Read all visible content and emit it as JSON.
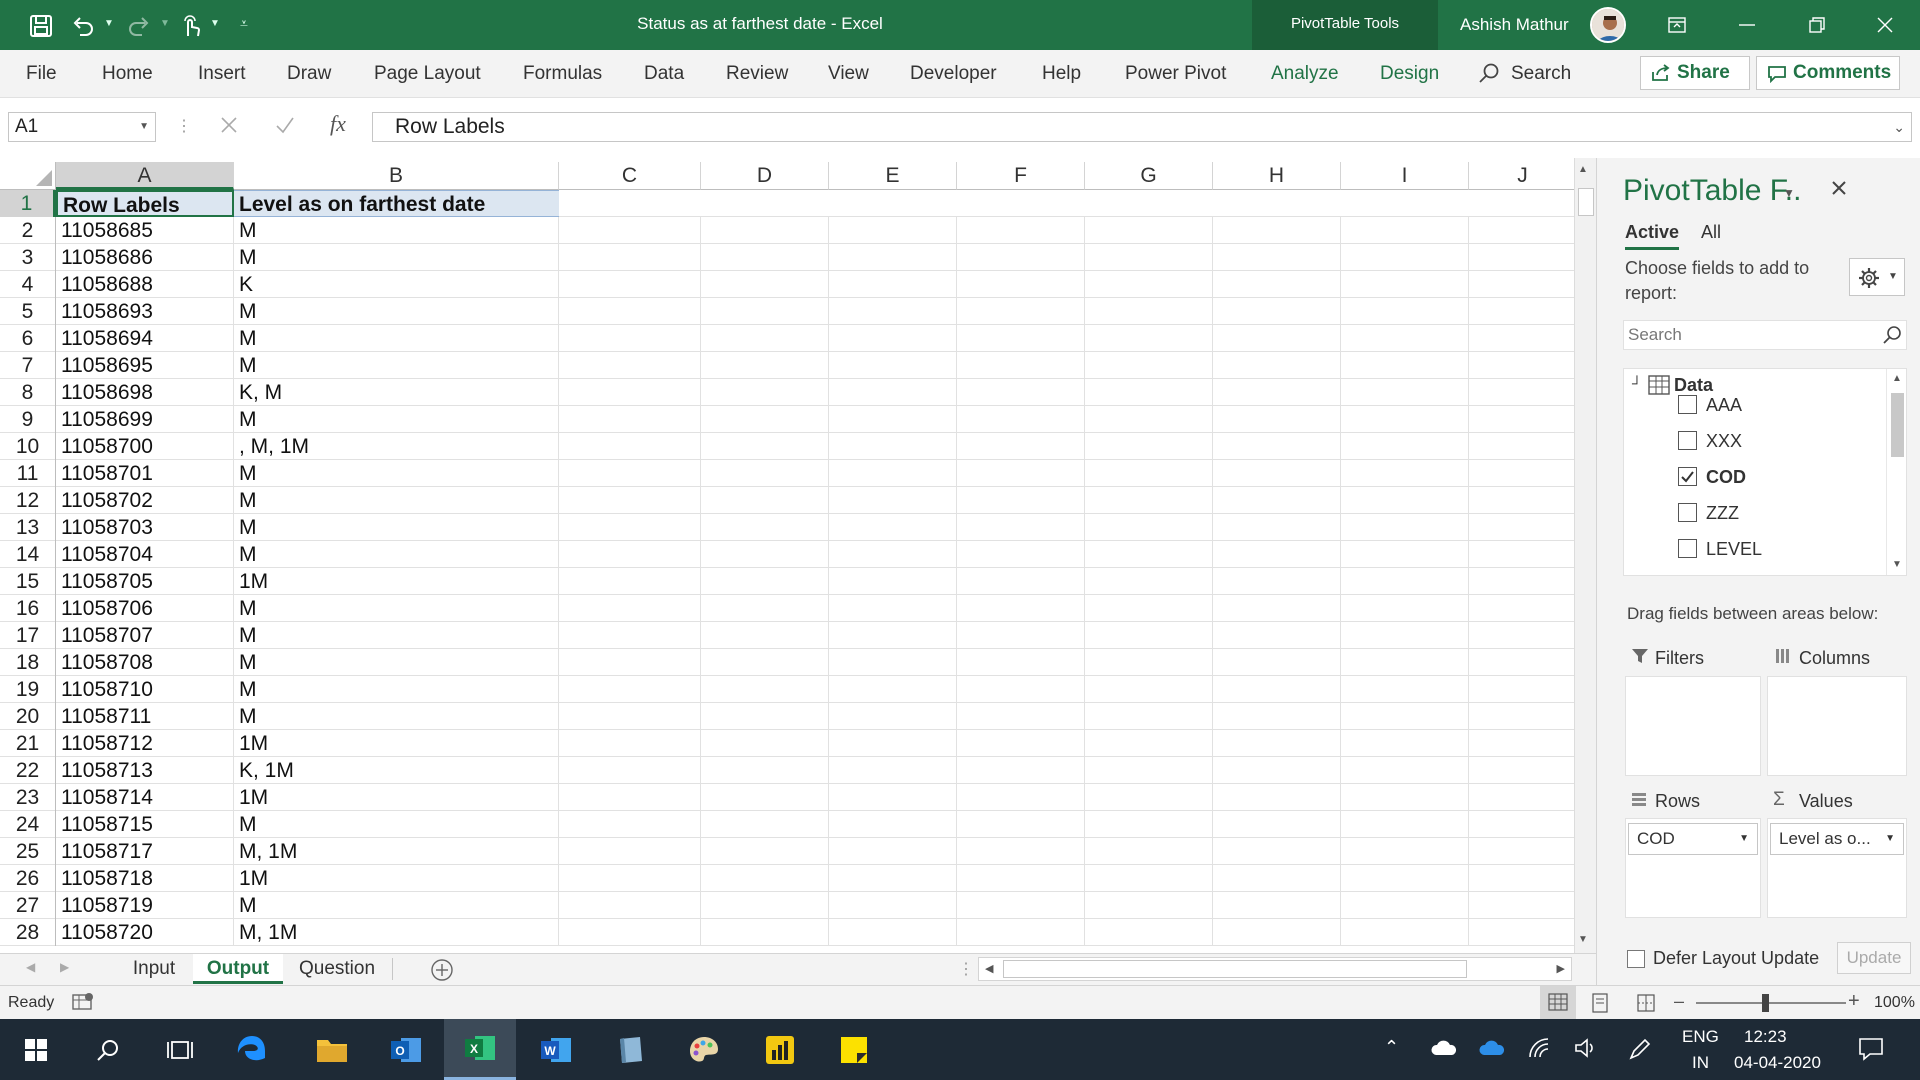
{
  "title_bar": {
    "title": "Status as at farthest date  -  Excel",
    "pivot_tools": "PivotTable Tools",
    "user": "Ashish Mathur"
  },
  "menu": {
    "items": [
      "File",
      "Home",
      "Insert",
      "Draw",
      "Page Layout",
      "Formulas",
      "Data",
      "Review",
      "View",
      "Developer",
      "Help",
      "Power Pivot",
      "Analyze",
      "Design"
    ],
    "search": "Search",
    "share": "Share",
    "comments": "Comments"
  },
  "formula_bar": {
    "name_box": "A1",
    "fx": "fx",
    "value": "Row Labels"
  },
  "grid": {
    "columns": [
      "A",
      "B",
      "C",
      "D",
      "E",
      "F",
      "G",
      "H",
      "I",
      "J"
    ],
    "header_row": {
      "row": "1",
      "a": "Row Labels",
      "b": "Level as on farthest date"
    },
    "rows": [
      {
        "n": "2",
        "a": "11058685",
        "b": "M"
      },
      {
        "n": "3",
        "a": "11058686",
        "b": "M"
      },
      {
        "n": "4",
        "a": "11058688",
        "b": "K"
      },
      {
        "n": "5",
        "a": "11058693",
        "b": "M"
      },
      {
        "n": "6",
        "a": "11058694",
        "b": "M"
      },
      {
        "n": "7",
        "a": "11058695",
        "b": "M"
      },
      {
        "n": "8",
        "a": "11058698",
        "b": "K, M"
      },
      {
        "n": "9",
        "a": "11058699",
        "b": "M"
      },
      {
        "n": "10",
        "a": "11058700",
        "b": ", M, 1M"
      },
      {
        "n": "11",
        "a": "11058701",
        "b": "M"
      },
      {
        "n": "12",
        "a": "11058702",
        "b": "M"
      },
      {
        "n": "13",
        "a": "11058703",
        "b": "M"
      },
      {
        "n": "14",
        "a": "11058704",
        "b": "M"
      },
      {
        "n": "15",
        "a": "11058705",
        "b": "1M"
      },
      {
        "n": "16",
        "a": "11058706",
        "b": "M"
      },
      {
        "n": "17",
        "a": "11058707",
        "b": "M"
      },
      {
        "n": "18",
        "a": "11058708",
        "b": "M"
      },
      {
        "n": "19",
        "a": "11058710",
        "b": "M"
      },
      {
        "n": "20",
        "a": "11058711",
        "b": "M"
      },
      {
        "n": "21",
        "a": "11058712",
        "b": "1M"
      },
      {
        "n": "22",
        "a": "11058713",
        "b": "K, 1M"
      },
      {
        "n": "23",
        "a": "11058714",
        "b": "1M"
      },
      {
        "n": "24",
        "a": "11058715",
        "b": "M"
      },
      {
        "n": "25",
        "a": "11058717",
        "b": "M, 1M"
      },
      {
        "n": "26",
        "a": "11058718",
        "b": "1M"
      },
      {
        "n": "27",
        "a": "11058719",
        "b": "M"
      },
      {
        "n": "28",
        "a": "11058720",
        "b": "M, 1M"
      }
    ]
  },
  "sheet_tabs": [
    "Input",
    "Output",
    "Question"
  ],
  "active_sheet": "Output",
  "status": {
    "ready": "Ready",
    "zoom": "100%"
  },
  "pivot_pane": {
    "title": "PivotTable F..",
    "tab_active": "Active",
    "tab_all": "All",
    "instructions": "Choose fields to add to report:",
    "search_placeholder": "Search",
    "table_name": "Data",
    "fields": [
      {
        "name": "AAA",
        "checked": false
      },
      {
        "name": "XXX",
        "checked": false
      },
      {
        "name": "COD",
        "checked": true
      },
      {
        "name": "ZZZ",
        "checked": false
      },
      {
        "name": "LEVEL",
        "checked": false
      }
    ],
    "drag_text": "Drag fields between areas below:",
    "filters": "Filters",
    "columns": "Columns",
    "rows": "Rows",
    "values": "Values",
    "rows_field": "COD",
    "values_field": "Level as o...",
    "defer": "Defer Layout Update",
    "update": "Update"
  },
  "taskbar": {
    "lang1": "ENG",
    "lang2": "IN",
    "time": "12:23",
    "date": "04-04-2020"
  },
  "colors": {
    "excel_green": "#217346",
    "header_fill": "#dce6f1",
    "taskbar": "#1e2a36"
  }
}
